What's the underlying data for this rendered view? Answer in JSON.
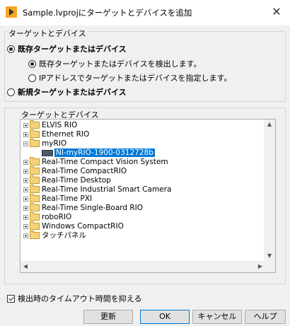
{
  "window": {
    "title": "Sample.lvprojにターゲットとデバイスを追加",
    "close_glyph": "✕"
  },
  "group": {
    "label": "ターゲットとデバイス",
    "existing_label": "既存ターゲットまたはデバイス",
    "discover_label": "既存ターゲットまたはデバイスを検出します。",
    "specify_ip_label": "IPアドレスでターゲットまたはデバイスを指定します。",
    "new_label": "新規ターゲットまたはデバイス"
  },
  "tree": {
    "label": "ターゲットとデバイス",
    "items": [
      {
        "label": "ELVIS RIO",
        "expanded": false
      },
      {
        "label": "Ethernet RIO",
        "expanded": false
      },
      {
        "label": "myRIO",
        "expanded": true
      },
      {
        "label": "NI-myRIO-1900-0312728b",
        "child": true,
        "selected": true
      },
      {
        "label": "Real-Time Compact Vision System",
        "expanded": false
      },
      {
        "label": "Real-Time CompactRIO",
        "expanded": false
      },
      {
        "label": "Real-Time Desktop",
        "expanded": false
      },
      {
        "label": "Real-Time Industrial Smart Camera",
        "expanded": false
      },
      {
        "label": "Real-Time PXI",
        "expanded": false
      },
      {
        "label": "Real-Time Single-Board RIO",
        "expanded": false
      },
      {
        "label": "roboRIO",
        "expanded": false
      },
      {
        "label": "Windows CompactRIO",
        "expanded": false
      },
      {
        "label": "タッチパネル",
        "expanded": false
      }
    ]
  },
  "timeout_label": "検出時のタイムアウト時間を抑える",
  "buttons": {
    "refresh": "更新",
    "ok": "OK",
    "cancel": "キャンセル",
    "help": "ヘルプ"
  },
  "colors": {
    "selection": "#0078d7",
    "folder": "#f3d27a"
  },
  "icons": {
    "collapsed": "plus-box",
    "expanded": "minus-box",
    "folder": "folder-icon",
    "device": "device-icon"
  }
}
